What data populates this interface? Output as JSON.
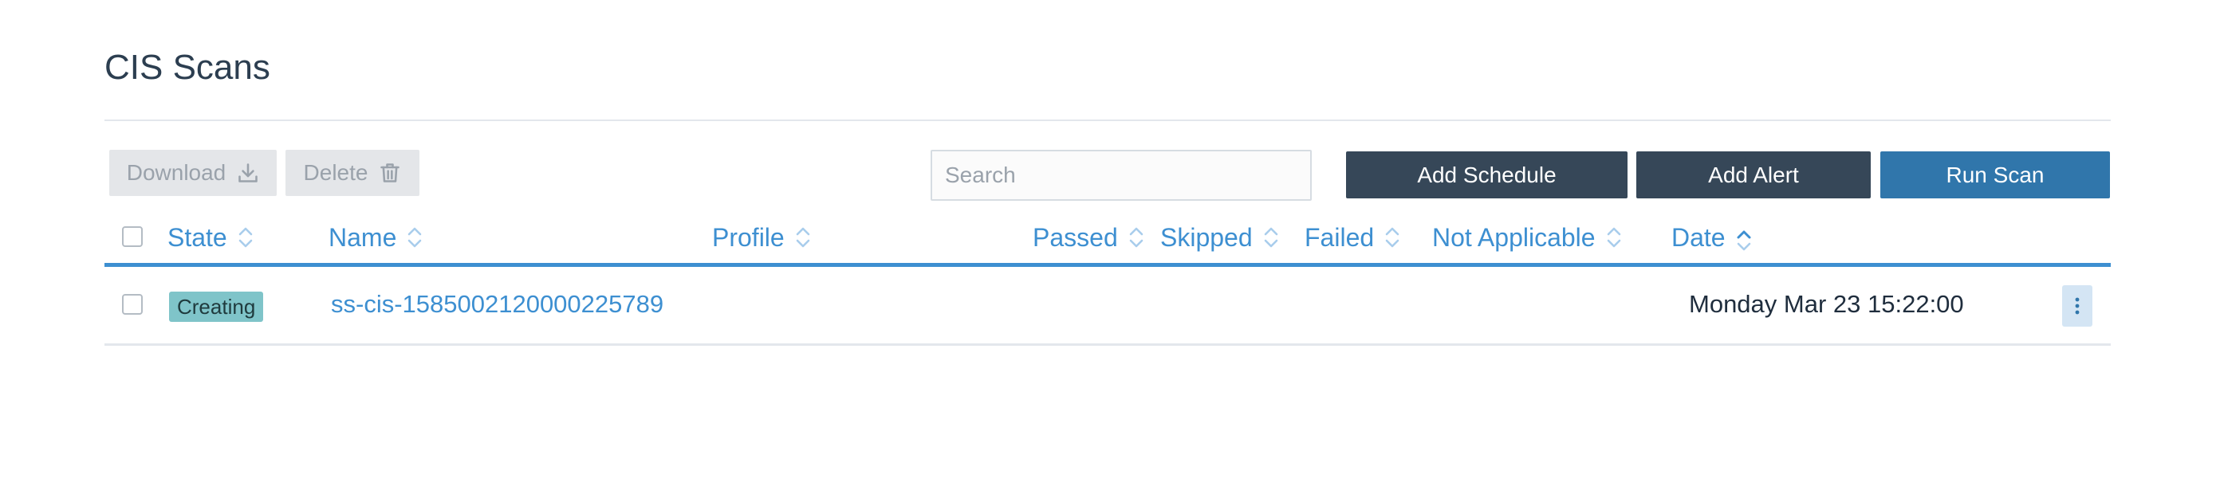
{
  "page": {
    "title": "CIS Scans"
  },
  "toolbar": {
    "download_label": "Download",
    "delete_label": "Delete",
    "search_placeholder": "Search",
    "add_schedule_label": "Add Schedule",
    "add_alert_label": "Add Alert",
    "run_scan_label": "Run Scan"
  },
  "table": {
    "columns": [
      "State",
      "Name",
      "Profile",
      "Passed",
      "Skipped",
      "Failed",
      "Not Applicable",
      "Date"
    ],
    "sorted_column": "Date",
    "sort_direction": "ascending",
    "rows": [
      {
        "state": "Creating",
        "name": "ss-cis-1585002120000225789",
        "profile": "",
        "passed": "",
        "skipped": "",
        "failed": "",
        "not_applicable": "",
        "date": "Monday Mar 23 15:22:00"
      }
    ]
  },
  "icons": {
    "download": "download-icon",
    "delete": "trash-icon",
    "sort": "sort-icon",
    "row_actions": "kebab-menu-icon"
  },
  "colors": {
    "accent_link": "#3d8fd1",
    "dark_button": "#364758",
    "primary_button": "#3076ab",
    "disabled_button": "#e4e6e9",
    "state_badge": "#7fc4c9"
  }
}
